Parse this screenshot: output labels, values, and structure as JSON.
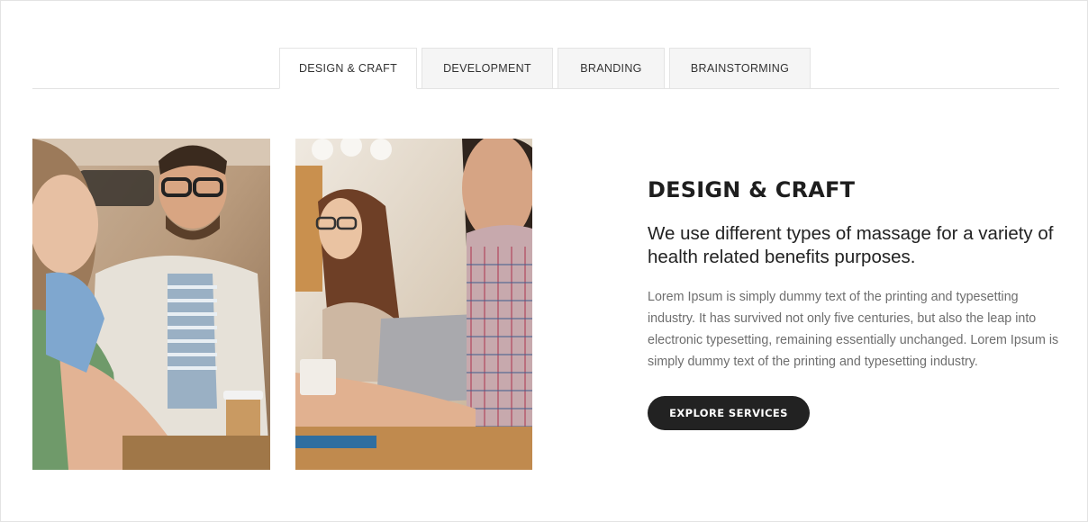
{
  "tabs": [
    {
      "label": "DESIGN & CRAFT",
      "active": true
    },
    {
      "label": "DEVELOPMENT",
      "active": false
    },
    {
      "label": "BRANDING",
      "active": false
    },
    {
      "label": "BRAINSTORMING",
      "active": false
    }
  ],
  "panel": {
    "title": "DESIGN & CRAFT",
    "subtitle": "We use different types of massage for a variety of health related benefits purposes.",
    "body": "Lorem Ipsum is simply dummy text of the printing and typesetting industry. It has survived not only five centuries, but also the leap into electronic typesetting, remaining essentially unchanged. Lorem Ipsum is simply dummy text of the printing and typesetting industry.",
    "cta_label": "EXPLORE SERVICES"
  },
  "images": {
    "left": "meeting-photo-man-smiling",
    "right": "meeting-photo-woman-laptop"
  },
  "colors": {
    "accent": "#222222",
    "tab_inactive_bg": "#f5f5f5",
    "body_text": "#6e6e6e"
  }
}
